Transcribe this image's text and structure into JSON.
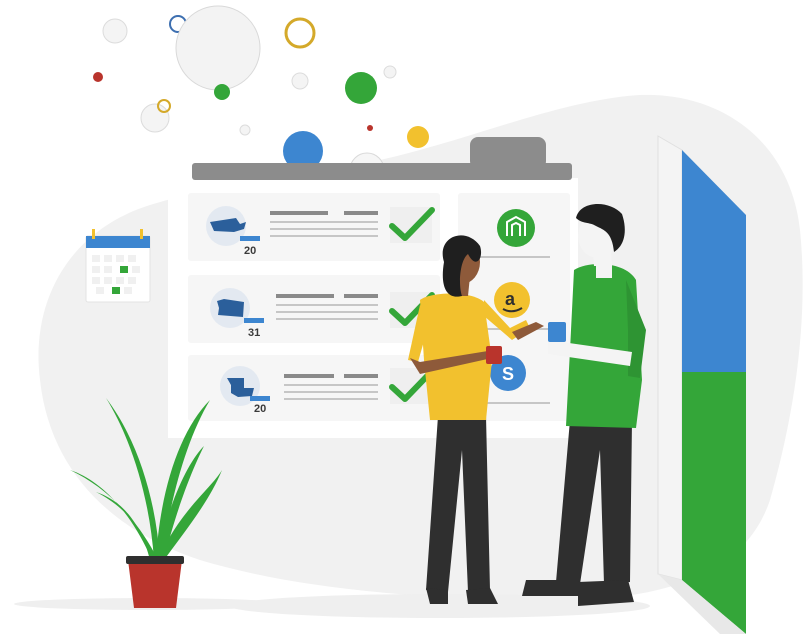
{
  "colors": {
    "blob": "#f1f1f1",
    "board": "#ffffff",
    "board_tab": "#8c8c8c",
    "accent_blue": "#3d86d0",
    "accent_green": "#34a639",
    "accent_yellow": "#f2c12e",
    "accent_red": "#b9342c",
    "dark": "#2f2f2f"
  },
  "rows": [
    {
      "state_icon": "massachusetts-map-icon",
      "count": "20",
      "status": "checkmark-icon"
    },
    {
      "state_icon": "washington-map-icon",
      "count": "31",
      "status": "checkmark-icon"
    },
    {
      "state_icon": "louisiana-map-icon",
      "count": "20",
      "status": "checkmark-icon"
    }
  ],
  "platforms": [
    "magento-logo-icon",
    "amazon-logo-icon",
    "shopify-logo-icon"
  ],
  "logo_letters": {
    "amazon": "a",
    "shopify": "S"
  }
}
